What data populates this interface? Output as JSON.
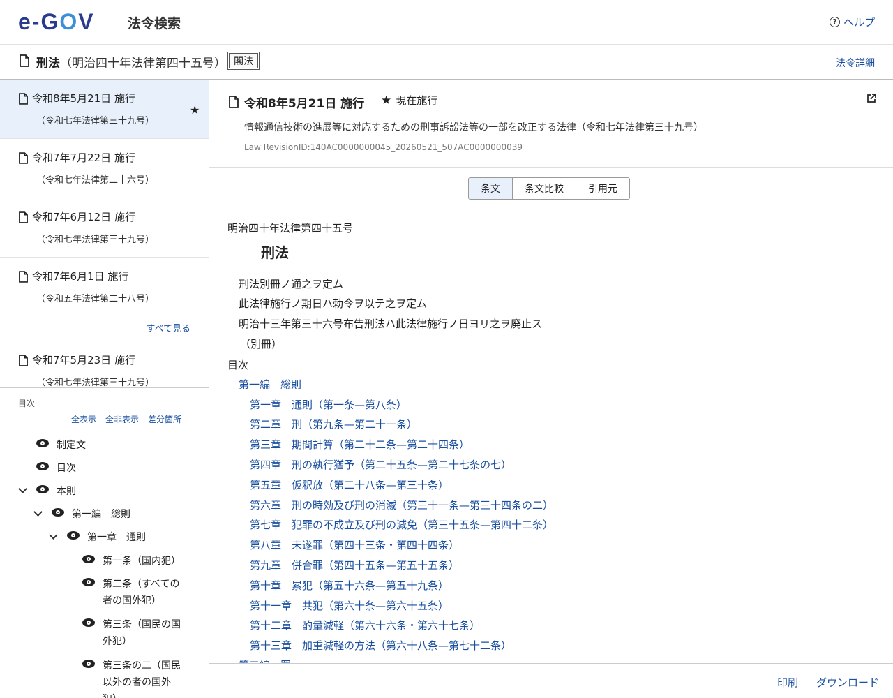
{
  "header": {
    "logo": "e-GOV",
    "site_title": "法令検索",
    "help_label": "ヘルプ"
  },
  "law": {
    "name": "刑法",
    "number": "（明治四十年法律第四十五号）",
    "badge": "閣法",
    "detail_link": "法令詳細"
  },
  "revisions": [
    {
      "date": "令和8年5月21日 施行",
      "law": "（令和七年法律第三十九号）",
      "active": true
    },
    {
      "date": "令和7年7月22日 施行",
      "law": "（令和七年法律第二十六号）"
    },
    {
      "date": "令和7年6月12日 施行",
      "law": "（令和七年法律第三十九号）"
    },
    {
      "date": "令和7年6月1日 施行",
      "law": "（令和五年法律第二十八号）"
    },
    {
      "date": "令和7年5月23日 施行",
      "law": "（令和七年法律第三十九号）"
    }
  ],
  "see_all": "すべて見る",
  "toc": {
    "label": "目次",
    "actions": [
      "全表示",
      "全非表示",
      "差分箇所"
    ],
    "items": [
      {
        "text": "制定文"
      },
      {
        "text": "目次"
      },
      {
        "text": "本則"
      },
      {
        "text": "第一編　総則"
      },
      {
        "text": "第一章　通則"
      },
      {
        "text": "第一条（国内犯）"
      },
      {
        "text": "第二条（すべての者の国外犯）"
      },
      {
        "text": "第三条（国民の国外犯）"
      },
      {
        "text": "第三条の二（国民以外の者の国外犯）"
      }
    ]
  },
  "current_revision": {
    "date": "令和8年5月21日 施行",
    "status": "現在施行",
    "amendment": "情報通信技術の進展等に対応するための刑事訴訟法等の一部を改正する法律（令和七年法律第三十九号）",
    "revision_id": "Law RevisionID:140AC0000000045_20260521_507AC0000000039"
  },
  "tabs": [
    "条文",
    "条文比較",
    "引用元"
  ],
  "body": {
    "law_number": "明治四十年法律第四十五号",
    "title": "刑法",
    "enact": [
      "刑法別冊ノ通之ヲ定ム",
      "此法律施行ノ期日ハ勅令ヲ以テ之ヲ定ム",
      "明治十三年第三十六号布告刑法ハ此法律施行ノ日ヨリ之ヲ廃止ス"
    ],
    "appendix": "（別冊）",
    "toc_heading": "目次",
    "part1": "第一編　総則",
    "chapters": [
      "第一章　通則（第一条—第八条）",
      "第二章　刑（第九条—第二十一条）",
      "第三章　期間計算（第二十二条—第二十四条）",
      "第四章　刑の執行猶予（第二十五条—第二十七条の七）",
      "第五章　仮釈放（第二十八条—第三十条）",
      "第六章　刑の時効及び刑の消滅（第三十一条—第三十四条の二）",
      "第七章　犯罪の不成立及び刑の減免（第三十五条—第四十二条）",
      "第八章　未遂罪（第四十三条・第四十四条）",
      "第九章　併合罪（第四十五条—第五十五条）",
      "第十章　累犯（第五十六条—第五十九条）",
      "第十一章　共犯（第六十条—第六十五条）",
      "第十二章　酌量減軽（第六十六条・第六十七条）",
      "第十三章　加重減軽の方法（第六十八条—第七十二条）"
    ],
    "part2": "第二編　罪"
  },
  "footer": {
    "print": "印刷",
    "download": "ダウンロード"
  },
  "colors": {
    "link": "#1a4fa0",
    "active_bg": "#e8f0fb",
    "logo_navy": "#2a3a8e"
  }
}
